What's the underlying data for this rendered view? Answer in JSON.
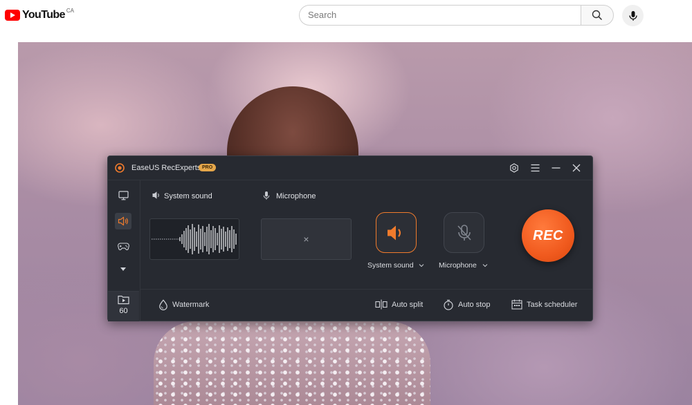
{
  "youtube": {
    "logo_text": "YouTube",
    "region": "CA",
    "search_placeholder": "Search"
  },
  "recorder": {
    "app_name": "EaseUS RecExperts",
    "badge": "PRO",
    "title_buttons": [
      "settings-icon",
      "menu-icon",
      "minimize-icon",
      "close-icon"
    ],
    "sidebar": {
      "items": [
        "monitor-icon",
        "speaker-icon",
        "gamepad-icon",
        "dropdown-arrow-icon"
      ],
      "active": "speaker-icon",
      "fps": "60"
    },
    "sources": {
      "system_label": "System sound",
      "mic_label": "Microphone",
      "mic_placeholder": "×"
    },
    "toggles": {
      "system": "System sound",
      "mic": "Microphone"
    },
    "rec_label": "REC",
    "bottom": {
      "watermark": "Watermark",
      "auto_split": "Auto split",
      "auto_stop": "Auto stop",
      "task_scheduler": "Task scheduler"
    },
    "colors": {
      "accent": "#f07b2c",
      "window_bg": "#272a31",
      "rec": "#f05a1e"
    }
  }
}
